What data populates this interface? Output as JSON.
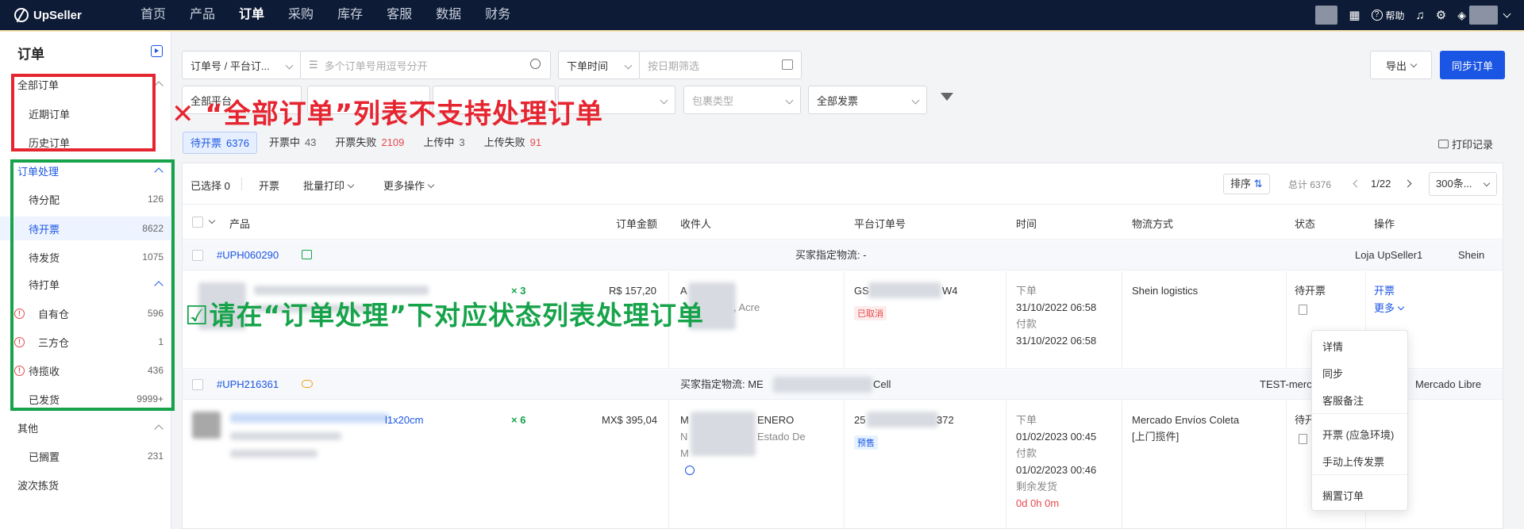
{
  "topnav": {
    "brand": "UpSeller",
    "items": [
      "首页",
      "产品",
      "订单",
      "采购",
      "库存",
      "客服",
      "数据",
      "财务"
    ],
    "help": "帮助"
  },
  "sidebar": {
    "title": "订单",
    "all_orders": "全部订单",
    "recent_orders": "近期订单",
    "history_orders": "历史订单",
    "processing": "订单处理",
    "to_assign": {
      "label": "待分配",
      "count": "126"
    },
    "to_invoice": {
      "label": "待开票",
      "count": "8622"
    },
    "to_ship": {
      "label": "待发货",
      "count": "1075"
    },
    "to_print": "待打单",
    "own_wh": {
      "label": "自有仓",
      "count": "596"
    },
    "third_wh": {
      "label": "三方仓",
      "count": "1"
    },
    "to_collect": {
      "label": "待揽收",
      "count": "436"
    },
    "shipped": {
      "label": "已发货",
      "count": "9999+"
    },
    "other": "其他",
    "shelved": {
      "label": "已搁置",
      "count": "231"
    },
    "wave_picking": "波次拣货"
  },
  "filters": {
    "order_no_type": "订单号 / 平台订...",
    "order_no_placeholder": "多个订单号用逗号分开",
    "time_type": "下单时间",
    "date_placeholder": "按日期筛选",
    "export": "导出",
    "sync": "同步订单",
    "all_platforms": "全部平台",
    "package_type": "包裹类型",
    "all_invoices": "全部发票"
  },
  "tabs": [
    {
      "label": "待开票",
      "count": "6376"
    },
    {
      "label": "开票中",
      "count": "43"
    },
    {
      "label": "开票失败",
      "count": "2109"
    },
    {
      "label": "上传中",
      "count": "3"
    },
    {
      "label": "上传失败",
      "count": "91"
    }
  ],
  "print_records": "打印记录",
  "toolbar": {
    "selected": "已选择",
    "selected_count": "0",
    "invoice": "开票",
    "batch_print": "批量打印",
    "more_ops": "更多操作",
    "sort": "排序",
    "total": "总计 6376",
    "page": "1/22",
    "page_size": "300条..."
  },
  "columns": [
    "产品",
    "订单金额",
    "收件人",
    "平台订单号",
    "时间",
    "物流方式",
    "状态",
    "操作"
  ],
  "orders": [
    {
      "id": "#UPH060290",
      "buyer_logistics": "买家指定物流: -",
      "shop": "Loja UpSeller1",
      "platform": "Shein",
      "qty": "× 3",
      "amount": "R$ 157,20",
      "recipient_prefix": "A",
      "recipient_addr": ", Acre",
      "platform_no_prefix": "GS",
      "platform_no_suffix": "W4",
      "platform_tag": "已取消",
      "time_order_label": "下单",
      "time_order": "31/10/2022 06:58",
      "time_pay_label": "付款",
      "time_pay": "31/10/2022 06:58",
      "logistics": "Shein logistics",
      "status": "待开票",
      "action_invoice": "开票",
      "action_more": "更多"
    },
    {
      "id": "#UPH216361",
      "buyer_logistics": "买家指定物流: ME",
      "buyer_logistics_suffix": "Cell",
      "shop": "TEST-merc",
      "platform": "Mercado Libre",
      "product_suffix": "l1x20cm",
      "qty": "× 6",
      "amount": "MX$ 395,04",
      "recipient_prefix": "M",
      "recipient_name_suffix": "ENERO",
      "recipient_l2_prefix": "N",
      "recipient_l2_suffix": "Estado De",
      "recipient_l3_prefix": "M",
      "platform_no_prefix": "25",
      "platform_no_suffix": "372",
      "platform_tag": "预售",
      "time_order_label": "下单",
      "time_order": "01/02/2023 00:45",
      "time_pay_label": "付款",
      "time_pay": "01/02/2023 00:46",
      "time_left_label": "剩余发货",
      "time_left": "0d 0h 0m",
      "logistics": "Mercado Envíos Coleta",
      "logistics_sub": "[上门揽件]",
      "status": "待开"
    }
  ],
  "more_menu": [
    "详情",
    "同步",
    "客服备注",
    "开票 (应急环境)",
    "手动上传发票",
    "搁置订单"
  ],
  "annotations": {
    "red": "“全部订单”列表不支持处理订单",
    "green": "请在“订单处理”下对应状态列表处理订单"
  }
}
